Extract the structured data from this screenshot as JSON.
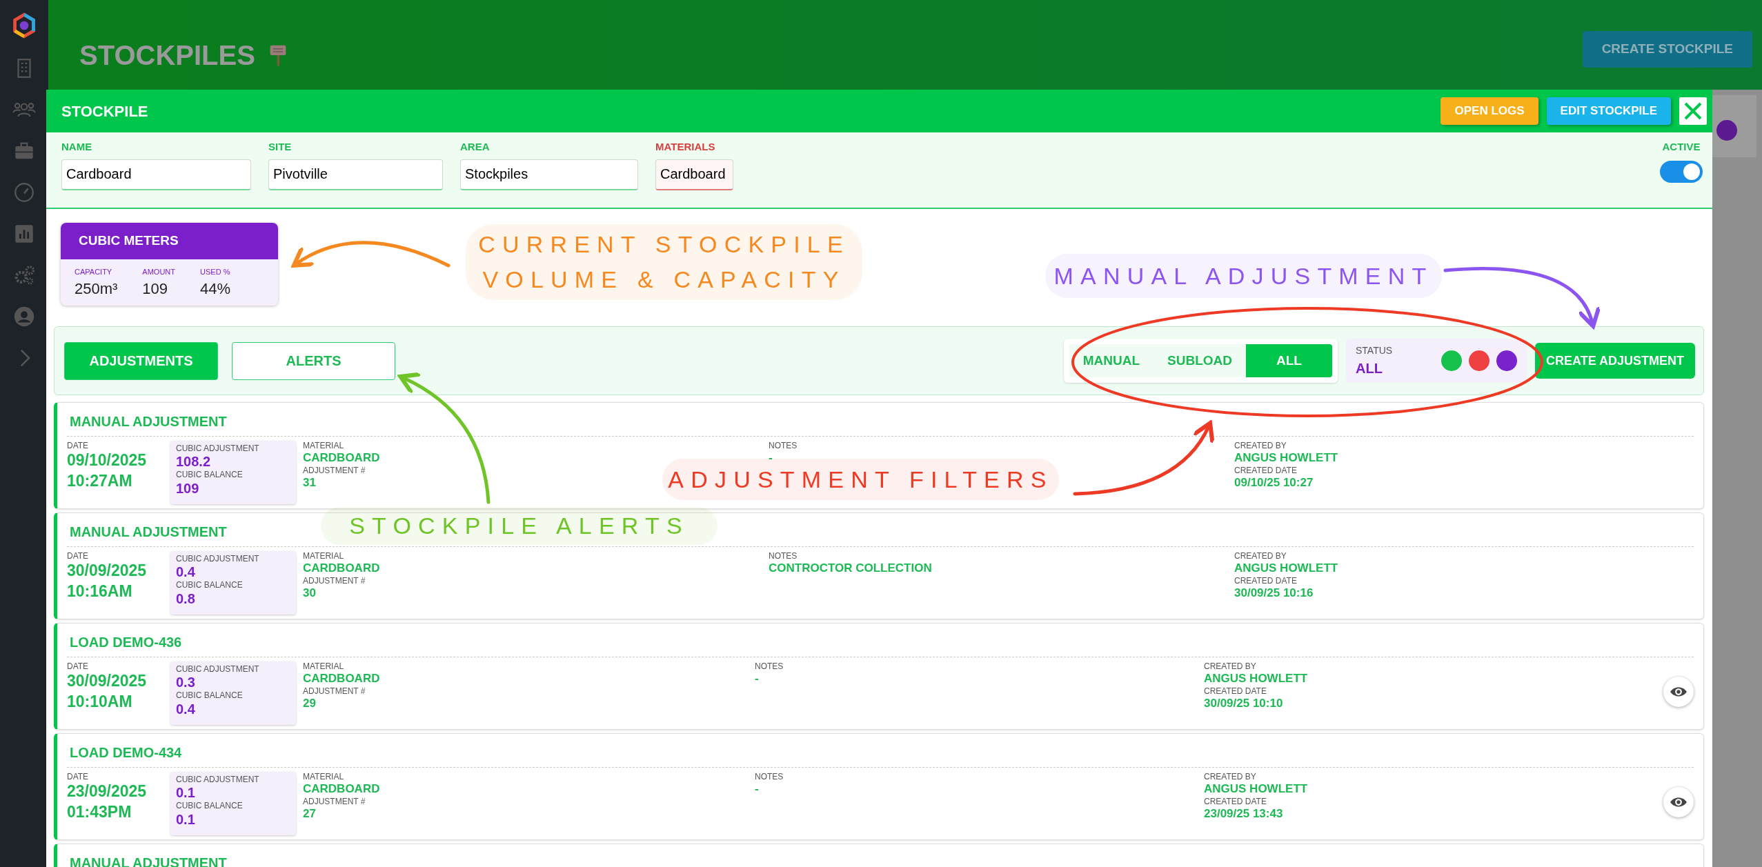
{
  "header": {
    "title": "STOCKPILES",
    "button": "CREATE STOCKPILE"
  },
  "background_card": {
    "color": "#5b1a8f"
  },
  "modal": {
    "title": "STOCKPILE",
    "buttons": [
      {
        "label": "OPEN LOGS",
        "kind": "logs"
      },
      {
        "label": "EDIT STOCKPILE",
        "kind": "edit"
      }
    ],
    "fields": [
      {
        "label": "NAME",
        "value": "Cardboard",
        "kind": "text"
      },
      {
        "label": "SITE",
        "value": "Pivotville",
        "kind": "text"
      },
      {
        "label": "AREA",
        "value": "Stockpiles",
        "kind": "text"
      },
      {
        "label": "MATERIALS",
        "value": "Cardboard",
        "kind": "material"
      }
    ],
    "active": {
      "label": "ACTIVE",
      "on": true
    }
  },
  "cubic_meters": {
    "title": "CUBIC METERS",
    "stats": [
      {
        "label": "CAPACITY",
        "value": "250m³"
      },
      {
        "label": "AMOUNT",
        "value": "109"
      },
      {
        "label": "USED %",
        "value": "44%"
      }
    ]
  },
  "tabs": [
    {
      "label": "ADJUSTMENTS",
      "selected": true
    },
    {
      "label": "ALERTS",
      "selected": false
    }
  ],
  "filters": [
    {
      "label": "MANUAL",
      "selected": false
    },
    {
      "label": "SUBLOAD",
      "selected": false
    },
    {
      "label": "ALL",
      "selected": true
    }
  ],
  "status": {
    "label": "STATUS",
    "value": "ALL",
    "dots": [
      {
        "color": "#16c24c"
      },
      {
        "color": "#ee4242"
      },
      {
        "color": "#7a22cc"
      }
    ]
  },
  "create_button": "CREATE ADJUSTMENT",
  "adjustments": [
    {
      "title": "MANUAL ADJUSTMENT",
      "kind": "manual",
      "date_label": "DATE",
      "date": "09/10/2025",
      "time": "10:27AM",
      "cubic_adjustment_label": "CUBIC ADJUSTMENT",
      "cubic_adjustment": "108.2",
      "cubic_balance_label": "CUBIC BALANCE",
      "cubic_balance": "109",
      "material_label": "MATERIAL",
      "material": "CARDBOARD",
      "adjustment_no_label": "ADJUSTMENT #",
      "adjustment_no": "31",
      "notes_label": "NOTES",
      "notes": "-",
      "created_by_label": "CREATED BY",
      "created_by": "ANGUS HOWLETT",
      "created_date_label": "CREATED DATE",
      "created_date": "09/10/25 10:27"
    },
    {
      "title": "MANUAL ADJUSTMENT",
      "kind": "manual",
      "date_label": "DATE",
      "date": "30/09/2025",
      "time": "10:16AM",
      "cubic_adjustment_label": "CUBIC ADJUSTMENT",
      "cubic_adjustment": "0.4",
      "cubic_balance_label": "CUBIC BALANCE",
      "cubic_balance": "0.8",
      "material_label": "MATERIAL",
      "material": "CARDBOARD",
      "adjustment_no_label": "ADJUSTMENT #",
      "adjustment_no": "30",
      "notes_label": "NOTES",
      "notes": "CONTROCTOR COLLECTION",
      "created_by_label": "CREATED BY",
      "created_by": "ANGUS HOWLETT",
      "created_date_label": "CREATED DATE",
      "created_date": "30/09/25 10:16"
    },
    {
      "title": "LOAD DEMO-436",
      "kind": "load",
      "date_label": "DATE",
      "date": "30/09/2025",
      "time": "10:10AM",
      "cubic_adjustment_label": "CUBIC ADJUSTMENT",
      "cubic_adjustment": "0.3",
      "cubic_balance_label": "CUBIC BALANCE",
      "cubic_balance": "0.4",
      "material_label": "MATERIAL",
      "material": "CARDBOARD",
      "adjustment_no_label": "ADJUSTMENT #",
      "adjustment_no": "29",
      "notes_label": "NOTES",
      "notes": "-",
      "created_by_label": "CREATED BY",
      "created_by": "ANGUS HOWLETT",
      "created_date_label": "CREATED DATE",
      "created_date": "30/09/25 10:10"
    },
    {
      "title": "LOAD DEMO-434",
      "kind": "load",
      "date_label": "DATE",
      "date": "23/09/2025",
      "time": "01:43PM",
      "cubic_adjustment_label": "CUBIC ADJUSTMENT",
      "cubic_adjustment": "0.1",
      "cubic_balance_label": "CUBIC BALANCE",
      "cubic_balance": "0.1",
      "material_label": "MATERIAL",
      "material": "CARDBOARD",
      "adjustment_no_label": "ADJUSTMENT #",
      "adjustment_no": "27",
      "notes_label": "NOTES",
      "notes": "-",
      "created_by_label": "CREATED BY",
      "created_by": "ANGUS HOWLETT",
      "created_date_label": "CREATED DATE",
      "created_date": "23/09/25 13:43"
    },
    {
      "title": "MANUAL ADJUSTMENT",
      "kind": "manual"
    }
  ],
  "annotations": [
    {
      "kind": "volume",
      "text": "CURRENT STOCKPILE\nVOLUME & CAPACITY",
      "color": "#f5891f"
    },
    {
      "kind": "manual",
      "text": "MANUAL ADJUSTMENT",
      "color": "#8d55f0"
    },
    {
      "kind": "filters",
      "text": "ADJUSTMENT FILTERS",
      "color": "#ee3a24"
    },
    {
      "kind": "alerts",
      "text": "STOCKPILE ALERTS",
      "color": "#6fc428"
    }
  ]
}
